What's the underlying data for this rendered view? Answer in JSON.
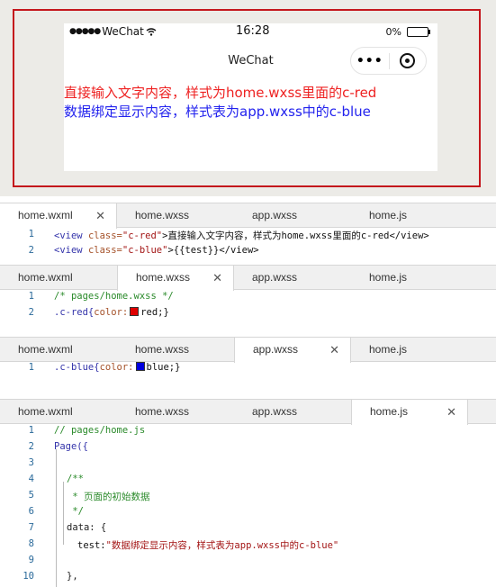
{
  "preview": {
    "status": {
      "carrier": "WeChat",
      "time": "16:28",
      "battery": "0%"
    },
    "nav_title": "WeChat",
    "more_icon": "more-dots-icon",
    "close_icon": "target-icon",
    "text_red": "直接输入文字内容，样式为home.wxss里面的c-red",
    "text_blue": "数据绑定显示内容，样式表为app.wxss中的c-blue",
    "colors": {
      "red": "#ee2222",
      "blue": "#2222ee",
      "frame": "#c4161c"
    }
  },
  "tabs": [
    "home.wxml",
    "home.wxss",
    "app.wxss",
    "home.js"
  ],
  "panels": [
    {
      "active_tab": "home.wxml",
      "lines": [
        {
          "n": "1",
          "a": "<view ",
          "b": "class=",
          "c": "\"c-red\"",
          "d": ">直接输入文字内容，样式为home.wxss里面的c-red</view>"
        },
        {
          "n": "2",
          "a": "<view ",
          "b": "class=",
          "c": "\"c-blue\"",
          "d": ">{{test}}</view>"
        }
      ]
    },
    {
      "active_tab": "home.wxss",
      "lines": [
        {
          "n": "1",
          "text": "/* pages/home.wxss */"
        },
        {
          "n": "2",
          "selector": ".c-red{",
          "prop": "color:",
          "value": "red;}",
          "swatch": "#e00000"
        }
      ]
    },
    {
      "active_tab": "app.wxss",
      "lines": [
        {
          "n": "1",
          "selector": ".c-blue{",
          "prop": "color:",
          "value": "blue;}",
          "swatch": "#0000e0"
        }
      ]
    },
    {
      "active_tab": "home.js",
      "lines": [
        {
          "n": "1",
          "text": "// pages/home.js"
        },
        {
          "n": "2",
          "text": "Page({"
        },
        {
          "n": "3",
          "text": ""
        },
        {
          "n": "4",
          "text": "/**"
        },
        {
          "n": "5",
          "text": " * 页面的初始数据"
        },
        {
          "n": "6",
          "text": " */"
        },
        {
          "n": "7",
          "text": "data: {"
        },
        {
          "n": "8",
          "key": "test:",
          "value": "\"数据绑定显示内容，样式表为app.wxss中的c-blue\""
        },
        {
          "n": "9",
          "text": ""
        },
        {
          "n": "10",
          "text": "},"
        }
      ]
    }
  ]
}
